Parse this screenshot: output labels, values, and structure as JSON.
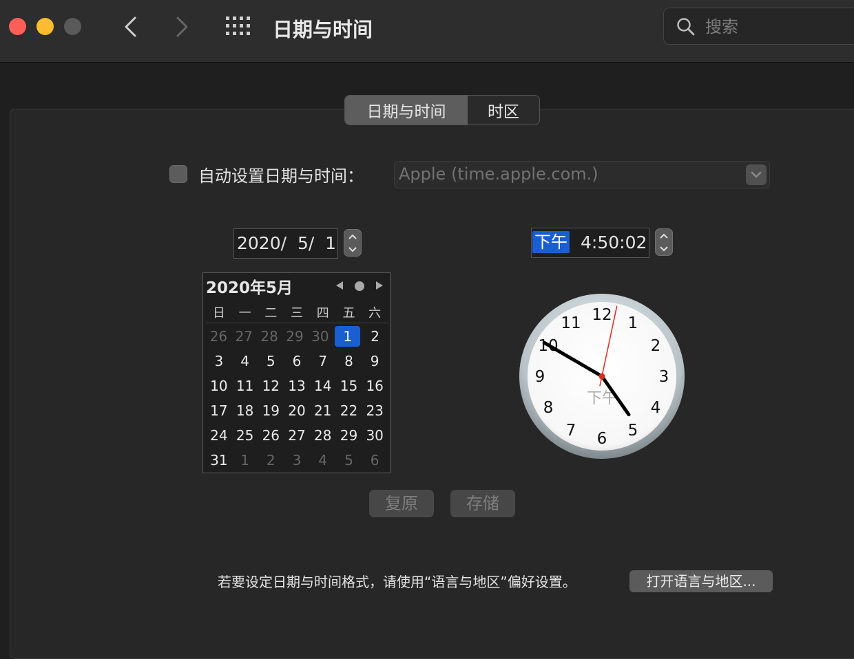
{
  "window": {
    "title": "日期与时间",
    "search_placeholder": "搜索"
  },
  "traffic_lights": {
    "close_color": "#ff5f57",
    "minimize_color": "#febc2e",
    "zoom_color": "#5a5a5a"
  },
  "tabs": [
    {
      "label": "日期与时间",
      "active": true
    },
    {
      "label": "时区",
      "active": false
    }
  ],
  "auto_set": {
    "label": "自动设置日期与时间：",
    "checked": false,
    "server_value": "Apple (time.apple.com.)"
  },
  "date_field": {
    "value": "2020/  5/  1"
  },
  "time_field": {
    "ampm": "下午",
    "time": "4:50:02"
  },
  "calendar": {
    "title": "2020年5月",
    "weekdays": [
      "日",
      "一",
      "二",
      "三",
      "四",
      "五",
      "六"
    ],
    "weeks": [
      [
        "26",
        "27",
        "28",
        "29",
        "30",
        "1",
        "2"
      ],
      [
        "3",
        "4",
        "5",
        "6",
        "7",
        "8",
        "9"
      ],
      [
        "10",
        "11",
        "12",
        "13",
        "14",
        "15",
        "16"
      ],
      [
        "17",
        "18",
        "19",
        "20",
        "21",
        "22",
        "23"
      ],
      [
        "24",
        "25",
        "26",
        "27",
        "28",
        "29",
        "30"
      ],
      [
        "31",
        "1",
        "2",
        "3",
        "4",
        "5",
        "6"
      ]
    ],
    "selected_day": "1",
    "accent_color": "#1a5fd1"
  },
  "clock": {
    "numerals": [
      "12",
      "1",
      "2",
      "3",
      "4",
      "5",
      "6",
      "7",
      "8",
      "9",
      "10",
      "11"
    ],
    "ampm_label": "下午",
    "hours": 4,
    "minutes": 50,
    "seconds": 2
  },
  "buttons": {
    "revert": "复原",
    "save": "存储",
    "open_language_region": "打开语言与地区..."
  },
  "footer_text": "若要设定日期与时间格式，请使用“语言与地区”偏好设置。"
}
